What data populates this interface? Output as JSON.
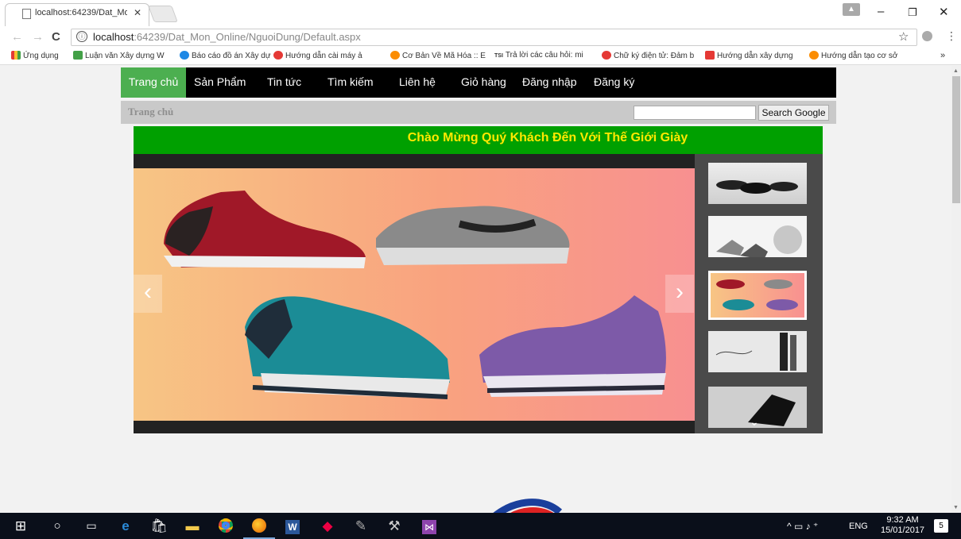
{
  "browser": {
    "tab_title": "localhost:64239/Dat_Mo",
    "address_host": "localhost",
    "address_rest": ":64239/Dat_Mon_Online/NguoiDung/Default.aspx",
    "info_icon": "ⓘ"
  },
  "bookmarks": [
    {
      "label": "Ứng dụng",
      "color": "#e53935"
    },
    {
      "label": "Luận văn Xây dựng W",
      "color": "#43a047"
    },
    {
      "label": "Báo cáo đồ án Xây dự",
      "color": "#1e88e5"
    },
    {
      "label": "Hướng dẫn cài máy ả",
      "color": "#e53935"
    },
    {
      "label": "Cơ Bản Về Mã Hóa :: E",
      "color": "#fb8c00"
    },
    {
      "label": "Trả lời các câu hỏi: mi",
      "color": "#333333"
    },
    {
      "label": "Chữ ký điện tử: Đảm b",
      "color": "#e53935"
    },
    {
      "label": "Hướng dẫn xây dựng",
      "color": "#e53935"
    },
    {
      "label": "Hướng dẫn tạo cơ sở",
      "color": "#fb8c00"
    }
  ],
  "bookmark_tsi": "TSI",
  "bookmark_more": "»",
  "nav": {
    "home": "Trang chủ",
    "products": "Sản Phẩm",
    "news": "Tin tức",
    "search": "Tìm kiếm",
    "contact": "Liên hệ",
    "cart": "Giỏ hàng",
    "login": "Đăng nhập",
    "register": "Đăng ký"
  },
  "breadcrumb": "Trang chủ",
  "search_button": "Search Google",
  "banner_text": "Chào Mừng Quý Khách Đến Với Thế Giới Giày",
  "taskbar": {
    "lang": "ENG",
    "time": "9:32 AM",
    "date": "15/01/2017",
    "notifications": "5"
  },
  "colors": {
    "nav_active": "#4caf50",
    "banner_bg": "#00a000",
    "banner_text": "#ffe800"
  }
}
